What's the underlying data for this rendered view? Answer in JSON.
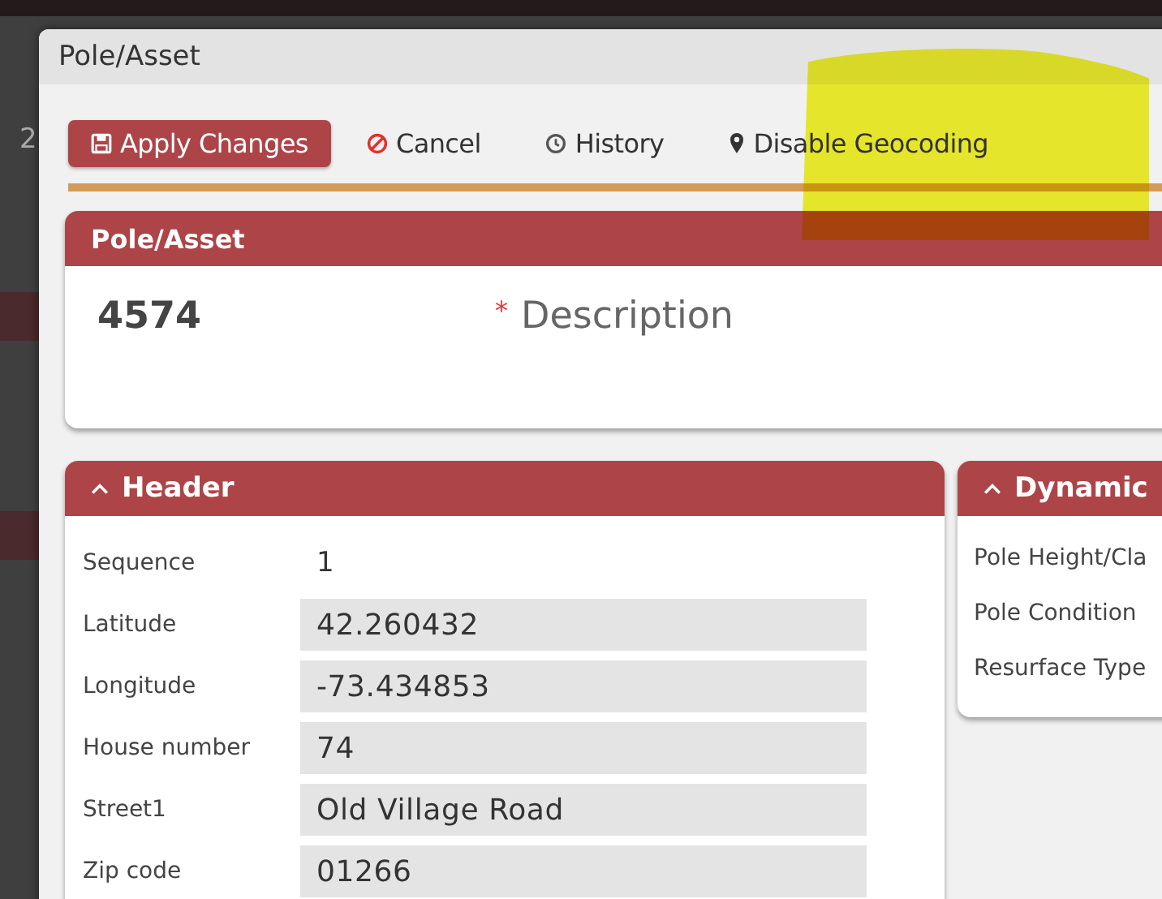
{
  "background_fragment": "2",
  "window": {
    "title": "Pole/Asset"
  },
  "toolbar": [
    {
      "kind": "apply",
      "label": "Apply Changes"
    },
    {
      "kind": "cancel",
      "label": "Cancel"
    },
    {
      "kind": "history",
      "label": "History"
    },
    {
      "kind": "geocode",
      "label": "Disable Geocoding"
    }
  ],
  "asset_card": {
    "title": "Pole/Asset",
    "number": "4574",
    "required_mark": "*",
    "description_label": "Description"
  },
  "header_section": {
    "title": "Header",
    "expanded": true,
    "fields": [
      {
        "label": "Sequence",
        "value": "1",
        "kind": "text"
      },
      {
        "label": "Latitude",
        "value": "42.260432",
        "kind": "input"
      },
      {
        "label": "Longitude",
        "value": "-73.434853",
        "kind": "input"
      },
      {
        "label": "House number",
        "value": "74",
        "kind": "input"
      },
      {
        "label": "Street1",
        "value": "Old Village Road",
        "kind": "input"
      },
      {
        "label": "Zip code",
        "value": "01266",
        "kind": "input"
      }
    ]
  },
  "dynamic_section": {
    "title": "Dynamic",
    "expanded": true,
    "fields": [
      {
        "label": "Pole Height/Cla"
      },
      {
        "label": "Pole Condition"
      },
      {
        "label": "Resurface Type"
      }
    ]
  }
}
